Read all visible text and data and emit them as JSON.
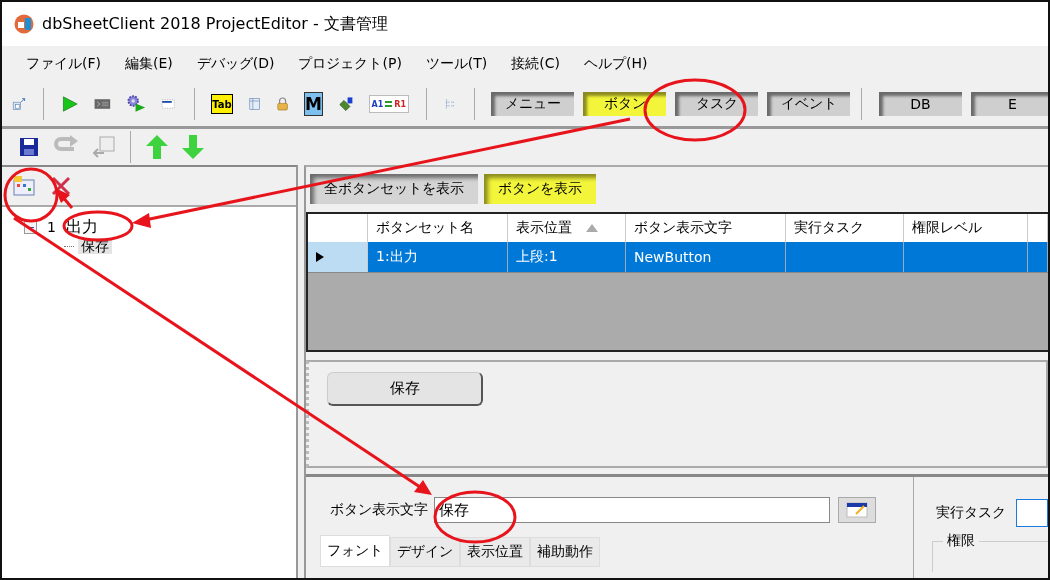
{
  "window": {
    "title": "dbSheetClient 2018 ProjectEditor - 文書管理"
  },
  "menu": [
    "ファイル(F)",
    "編集(E)",
    "デバッグ(D)",
    "プロジェクト(P)",
    "ツール(T)",
    "接続(C)",
    "ヘルプ(H)"
  ],
  "toolbar_glyphs": [
    "Tab",
    "M",
    "A1",
    "R1"
  ],
  "toolbar_tabs": [
    {
      "label": "メニュー",
      "selected": false
    },
    {
      "label": "ボタン",
      "selected": true
    },
    {
      "label": "タスク",
      "selected": false
    },
    {
      "label": "イベント",
      "selected": false
    },
    {
      "label": "DB",
      "selected": false
    },
    {
      "label": "E",
      "selected": false
    }
  ],
  "tree": [
    {
      "number": "1",
      "label": "出力",
      "expanded": true,
      "children": [
        {
          "label": "保存",
          "selected": true
        }
      ]
    }
  ],
  "view_buttons": [
    {
      "label": "全ボタンセットを表示",
      "selected": false
    },
    {
      "label": "ボタンを表示",
      "selected": true
    }
  ],
  "grid": {
    "columns": [
      {
        "label": "ボタンセット名",
        "sorted": false
      },
      {
        "label": "表示位置",
        "sorted": true
      },
      {
        "label": "ボタン表示文字",
        "sorted": false
      },
      {
        "label": "実行タスク",
        "sorted": false
      },
      {
        "label": "権限レベル",
        "sorted": false
      }
    ],
    "rows": [
      {
        "selected": true,
        "cells": [
          "1:出力",
          "上段:1",
          "NewButton"
        ]
      }
    ]
  },
  "preview": {
    "buttons": [
      "保存"
    ]
  },
  "editor": {
    "text_label": "ボタン表示文字",
    "text_value": "保存",
    "task_label": "実行タスク",
    "group_label": "権限",
    "tabs": [
      {
        "label": "フォント",
        "selected": true
      },
      {
        "label": "デザイン",
        "selected": false
      },
      {
        "label": "表示位置",
        "selected": false
      },
      {
        "label": "補助動作",
        "selected": false
      }
    ]
  }
}
